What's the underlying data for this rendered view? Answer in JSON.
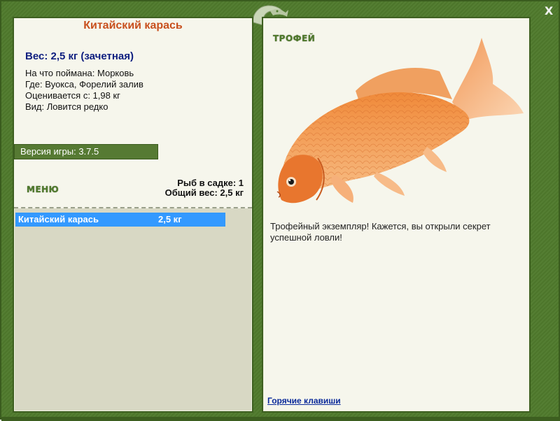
{
  "details": {
    "fish_name": "Китайский карась",
    "weight_line": "Вес: 2,5 кг (зачетная)",
    "bait_line": "На что поймана: Морковь",
    "location_line": "Где: Вуокса, Форелий залив",
    "value_line": "Оценивается с: 1,98 кг",
    "rarity_line": "Вид: Ловится редко"
  },
  "version": {
    "text": "Версия игры: 3.7.5"
  },
  "menu": {
    "label": "МЕНЮ"
  },
  "keepnet": {
    "count_line": "Рыб в садке: 1",
    "total_weight_line": "Общий вес: 2,5 кг"
  },
  "catch_list": [
    {
      "name": "Китайский карась",
      "weight": "2,5 кг",
      "selected": true
    }
  ],
  "trophy": {
    "label": "ТРОФЕЙ",
    "description": "Трофейный экземпляр! Кажется, вы открыли секрет успешной ловли!"
  },
  "footer": {
    "hotkeys": "Горячие клавиши"
  },
  "window": {
    "close_glyph": "X"
  },
  "colors": {
    "frame": "#4f7a2c",
    "fish_name": "#c8501e",
    "weight": "#102080",
    "selection": "#3399ff"
  }
}
